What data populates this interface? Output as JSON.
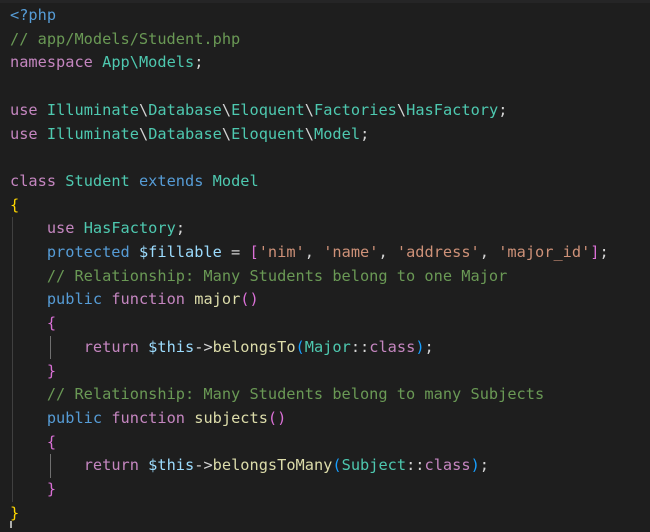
{
  "editor": {
    "language": "php",
    "file_comment": "// app/Models/Student.php",
    "colors": {
      "background": "#1e1e1e",
      "comment": "#6a9955",
      "keyword": "#c586c0",
      "storage": "#569cd6",
      "type": "#4ec9b0",
      "function": "#dcdcaa",
      "variable": "#9cdcfe",
      "string": "#ce9178",
      "text": "#d4d4d4",
      "bracket_level1": "#ffd700",
      "bracket_level2": "#da70d6",
      "bracket_level3": "#179fff"
    },
    "lines": [
      [
        {
          "t": "<?php",
          "c": "storage"
        }
      ],
      [
        {
          "t": "// app/Models/Student.php",
          "c": "comment"
        }
      ],
      [
        {
          "t": "namespace",
          "c": "kw"
        },
        {
          "t": " ",
          "c": "plain"
        },
        {
          "t": "App\\Models",
          "c": "ns"
        },
        {
          "t": ";",
          "c": "plain"
        }
      ],
      [],
      [
        {
          "t": "use",
          "c": "kw"
        },
        {
          "t": " ",
          "c": "plain"
        },
        {
          "t": "Illuminate",
          "c": "ns"
        },
        {
          "t": "\\",
          "c": "plain"
        },
        {
          "t": "Database",
          "c": "ns"
        },
        {
          "t": "\\",
          "c": "plain"
        },
        {
          "t": "Eloquent",
          "c": "ns"
        },
        {
          "t": "\\",
          "c": "plain"
        },
        {
          "t": "Factories",
          "c": "ns"
        },
        {
          "t": "\\",
          "c": "plain"
        },
        {
          "t": "HasFactory",
          "c": "class"
        },
        {
          "t": ";",
          "c": "plain"
        }
      ],
      [
        {
          "t": "use",
          "c": "kw"
        },
        {
          "t": " ",
          "c": "plain"
        },
        {
          "t": "Illuminate",
          "c": "ns"
        },
        {
          "t": "\\",
          "c": "plain"
        },
        {
          "t": "Database",
          "c": "ns"
        },
        {
          "t": "\\",
          "c": "plain"
        },
        {
          "t": "Eloquent",
          "c": "ns"
        },
        {
          "t": "\\",
          "c": "plain"
        },
        {
          "t": "Model",
          "c": "class"
        },
        {
          "t": ";",
          "c": "plain"
        }
      ],
      [],
      [
        {
          "t": "class",
          "c": "kw"
        },
        {
          "t": " ",
          "c": "plain"
        },
        {
          "t": "Student",
          "c": "class"
        },
        {
          "t": " ",
          "c": "plain"
        },
        {
          "t": "extends",
          "c": "storage"
        },
        {
          "t": " ",
          "c": "plain"
        },
        {
          "t": "Model",
          "c": "class"
        }
      ],
      [
        {
          "t": "{",
          "c": "brace1"
        }
      ],
      [
        {
          "t": "    ",
          "c": "plain"
        },
        {
          "t": "use",
          "c": "kw"
        },
        {
          "t": " ",
          "c": "plain"
        },
        {
          "t": "HasFactory",
          "c": "class"
        },
        {
          "t": ";",
          "c": "plain"
        }
      ],
      [
        {
          "t": "    ",
          "c": "plain"
        },
        {
          "t": "protected",
          "c": "storage"
        },
        {
          "t": " ",
          "c": "plain"
        },
        {
          "t": "$fillable",
          "c": "var"
        },
        {
          "t": " = ",
          "c": "plain"
        },
        {
          "t": "[",
          "c": "brace2"
        },
        {
          "t": "'nim'",
          "c": "str"
        },
        {
          "t": ", ",
          "c": "plain"
        },
        {
          "t": "'name'",
          "c": "str"
        },
        {
          "t": ", ",
          "c": "plain"
        },
        {
          "t": "'address'",
          "c": "str"
        },
        {
          "t": ", ",
          "c": "plain"
        },
        {
          "t": "'major_id'",
          "c": "str"
        },
        {
          "t": "]",
          "c": "brace2"
        },
        {
          "t": ";",
          "c": "plain"
        }
      ],
      [
        {
          "t": "    ",
          "c": "plain"
        },
        {
          "t": "// Relationship: Many Students belong to one Major",
          "c": "comment"
        }
      ],
      [
        {
          "t": "    ",
          "c": "plain"
        },
        {
          "t": "public",
          "c": "storage"
        },
        {
          "t": " ",
          "c": "plain"
        },
        {
          "t": "function",
          "c": "kw"
        },
        {
          "t": " ",
          "c": "plain"
        },
        {
          "t": "major",
          "c": "fn"
        },
        {
          "t": "()",
          "c": "brace2"
        }
      ],
      [
        {
          "t": "    ",
          "c": "plain"
        },
        {
          "t": "{",
          "c": "brace2"
        }
      ],
      [
        {
          "t": "        ",
          "c": "plain"
        },
        {
          "t": "return",
          "c": "kw"
        },
        {
          "t": " ",
          "c": "plain"
        },
        {
          "t": "$this",
          "c": "var"
        },
        {
          "t": "->",
          "c": "plain"
        },
        {
          "t": "belongsTo",
          "c": "fn"
        },
        {
          "t": "(",
          "c": "brace3"
        },
        {
          "t": "Major",
          "c": "class"
        },
        {
          "t": "::",
          "c": "plain"
        },
        {
          "t": "class",
          "c": "kw"
        },
        {
          "t": ")",
          "c": "brace3"
        },
        {
          "t": ";",
          "c": "plain"
        }
      ],
      [
        {
          "t": "    ",
          "c": "plain"
        },
        {
          "t": "}",
          "c": "brace2"
        }
      ],
      [
        {
          "t": "    ",
          "c": "plain"
        },
        {
          "t": "// Relationship: Many Students belong to many Subjects",
          "c": "comment"
        }
      ],
      [
        {
          "t": "    ",
          "c": "plain"
        },
        {
          "t": "public",
          "c": "storage"
        },
        {
          "t": " ",
          "c": "plain"
        },
        {
          "t": "function",
          "c": "kw"
        },
        {
          "t": " ",
          "c": "plain"
        },
        {
          "t": "subjects",
          "c": "fn"
        },
        {
          "t": "()",
          "c": "brace2"
        }
      ],
      [
        {
          "t": "    ",
          "c": "plain"
        },
        {
          "t": "{",
          "c": "brace2"
        }
      ],
      [
        {
          "t": "        ",
          "c": "plain"
        },
        {
          "t": "return",
          "c": "kw"
        },
        {
          "t": " ",
          "c": "plain"
        },
        {
          "t": "$this",
          "c": "var"
        },
        {
          "t": "->",
          "c": "plain"
        },
        {
          "t": "belongsToMany",
          "c": "fn"
        },
        {
          "t": "(",
          "c": "brace3"
        },
        {
          "t": "Subject",
          "c": "class"
        },
        {
          "t": "::",
          "c": "plain"
        },
        {
          "t": "class",
          "c": "kw"
        },
        {
          "t": ")",
          "c": "brace3"
        },
        {
          "t": ";",
          "c": "plain"
        }
      ],
      [
        {
          "t": "    ",
          "c": "plain"
        },
        {
          "t": "}",
          "c": "brace2"
        }
      ],
      [
        {
          "t": "}",
          "c": "brace1"
        }
      ]
    ]
  }
}
